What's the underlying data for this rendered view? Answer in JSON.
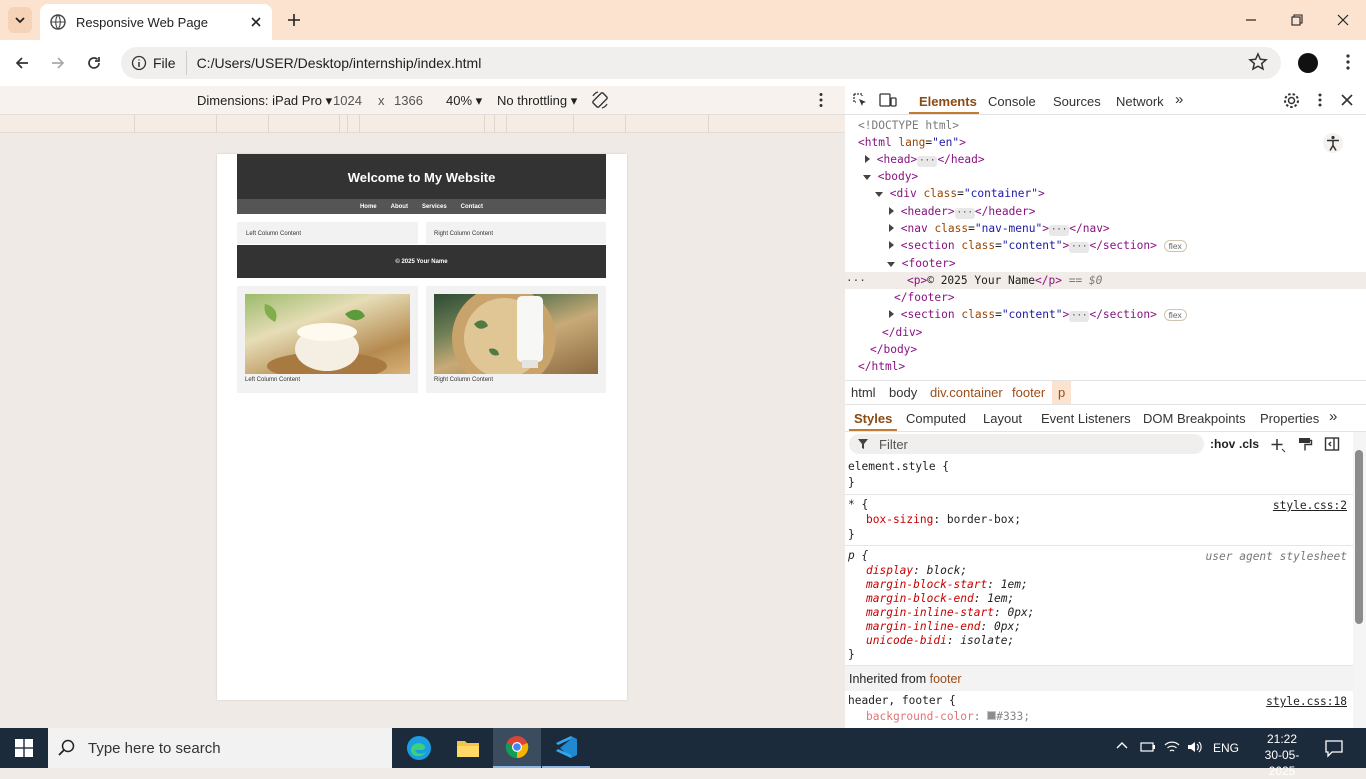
{
  "browser": {
    "tab_title": "Responsive Web Page",
    "chip_label": "File",
    "url": "C:/Users/USER/Desktop/internship/index.html"
  },
  "device_toolbar": {
    "dimensions_label": "Dimensions: iPad Pro",
    "width": "1024",
    "times": "x",
    "height": "1366",
    "zoom": "40%",
    "throttling": "No throttling"
  },
  "site": {
    "title": "Welcome to My Website",
    "nav": [
      "Home",
      "About",
      "Services",
      "Contact"
    ],
    "left_column": "Left Column Content",
    "right_column": "Right Column Content",
    "footer": "© 2025 Your Name",
    "left_card_caption": "Left Column Content",
    "right_card_caption": "Right Column Content"
  },
  "devtools": {
    "tabs": [
      "Elements",
      "Console",
      "Sources",
      "Network"
    ],
    "active_tab": "Elements",
    "dom": {
      "doctype": "<!DOCTYPE html>",
      "html_open": "<html ",
      "html_attr": "lang",
      "html_val": "\"en\"",
      "head": "<head>",
      "head_close": "</head>",
      "body": "<body>",
      "div_open": "<div ",
      "class_attr": "class",
      "container_val": "\"container\"",
      "header": "<header>",
      "header_close": "</header>",
      "nav_open": "<nav ",
      "nav_val": "\"nav-menu\"",
      "nav_close": "</nav>",
      "section_open": "<section ",
      "content_val": "\"content\"",
      "section_close": "</section>",
      "flex_badge": "flex",
      "footer": "<footer>",
      "p_open": "<p>",
      "p_text": "© 2025 Your Name",
      "p_close": "</p>",
      "eq": " == $0",
      "footer_close": "</footer>",
      "div_close": "</div>",
      "body_close": "</body>",
      "html_close": "</html>",
      "ellipsis": "···"
    },
    "breadcrumbs": [
      "html",
      "body",
      "div.container",
      "footer",
      "p"
    ],
    "style_tabs": [
      "Styles",
      "Computed",
      "Layout",
      "Event Listeners",
      "DOM Breakpoints",
      "Properties"
    ],
    "filter_placeholder": "Filter",
    "hov": ":hov",
    "cls": ".cls",
    "styles": {
      "element_style": "element.style {",
      "close": "}",
      "universal": "* {",
      "universal_src": "style.css:2",
      "box_sizing_p": "box-sizing",
      "box_sizing_v": "border-box;",
      "p_sel": "p {",
      "ua_src": "user agent stylesheet",
      "ua_props": [
        {
          "p": "display",
          "v": "block;"
        },
        {
          "p": "margin-block-start",
          "v": "1em;"
        },
        {
          "p": "margin-block-end",
          "v": "1em;"
        },
        {
          "p": "margin-inline-start",
          "v": "0px;"
        },
        {
          "p": "margin-inline-end",
          "v": "0px;"
        },
        {
          "p": "unicode-bidi",
          "v": "isolate;"
        }
      ],
      "inherited_label": "Inherited from",
      "inherited_from": "footer",
      "hf_sel": "header, footer {",
      "hf_src": "style.css:18",
      "bg_p": "background-color",
      "bg_v": "#333;"
    }
  },
  "taskbar": {
    "search_placeholder": "Type here to search",
    "lang": "ENG",
    "time": "21:22",
    "date": "30-05-2025"
  },
  "colors": {
    "titlebar": "#fbe3cf",
    "accent": "#c27b35",
    "site_header": "#333333",
    "site_nav": "#555555",
    "taskbar": "#1c2b3b"
  }
}
